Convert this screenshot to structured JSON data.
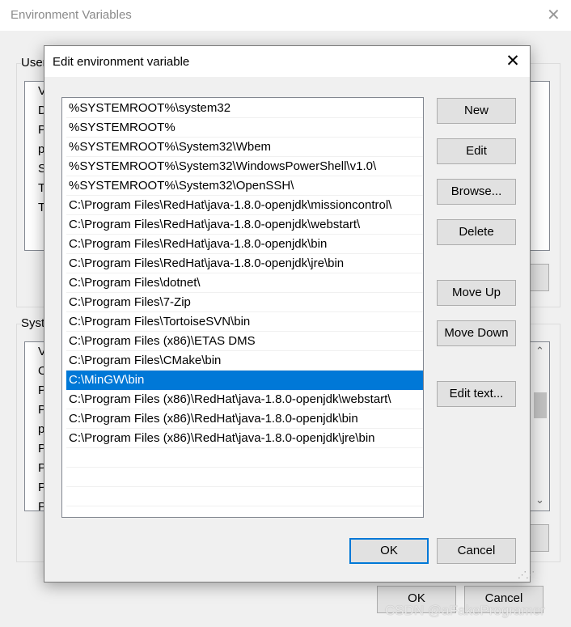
{
  "background_window": {
    "title": "Environment Variables",
    "user_group_label": "User",
    "user_list_items": [
      "Va",
      "Di",
      "Pa",
      "pk",
      "SA",
      "TE",
      "TM"
    ],
    "system_group_label": "Syste",
    "system_list_items": [
      "Va",
      "OS",
      "Pa",
      "PA",
      "pk",
      "PR",
      "PR",
      "PR",
      "PR"
    ],
    "ok_label": "OK",
    "cancel_label": "Cancel"
  },
  "dialog": {
    "title": "Edit environment variable",
    "paths": [
      "%SYSTEMROOT%\\system32",
      "%SYSTEMROOT%",
      "%SYSTEMROOT%\\System32\\Wbem",
      "%SYSTEMROOT%\\System32\\WindowsPowerShell\\v1.0\\",
      "%SYSTEMROOT%\\System32\\OpenSSH\\",
      "C:\\Program Files\\RedHat\\java-1.8.0-openjdk\\missioncontrol\\",
      "C:\\Program Files\\RedHat\\java-1.8.0-openjdk\\webstart\\",
      "C:\\Program Files\\RedHat\\java-1.8.0-openjdk\\bin",
      "C:\\Program Files\\RedHat\\java-1.8.0-openjdk\\jre\\bin",
      "C:\\Program Files\\dotnet\\",
      "C:\\Program Files\\7-Zip",
      "C:\\Program Files\\TortoiseSVN\\bin",
      "C:\\Program Files (x86)\\ETAS DMS",
      "C:\\Program Files\\CMake\\bin",
      "C:\\MinGW\\bin",
      "C:\\Program Files (x86)\\RedHat\\java-1.8.0-openjdk\\webstart\\",
      "C:\\Program Files (x86)\\RedHat\\java-1.8.0-openjdk\\bin",
      "C:\\Program Files (x86)\\RedHat\\java-1.8.0-openjdk\\jre\\bin"
    ],
    "selected_index": 14,
    "buttons": {
      "new": "New",
      "edit": "Edit",
      "browse": "Browse...",
      "delete": "Delete",
      "move_up": "Move Up",
      "move_down": "Move Down",
      "edit_text": "Edit text...",
      "ok": "OK",
      "cancel": "Cancel"
    }
  },
  "watermark": "CSDN @aFakeProgramer",
  "colors": {
    "selection": "#0078d7",
    "button_face": "#e1e1e1",
    "window_bg": "#f0f0f0"
  }
}
